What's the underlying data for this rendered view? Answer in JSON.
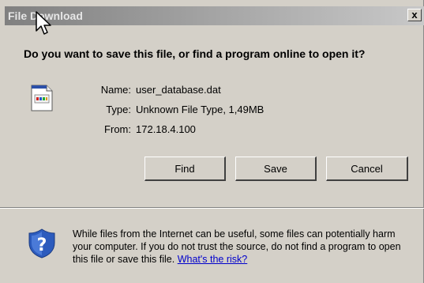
{
  "dialog": {
    "title": "File Download",
    "close_label": "x",
    "question": "Do you want to save this file, or find a program online to open it?"
  },
  "file": {
    "icon": "file-dat-icon",
    "name_label": "Name:",
    "name_value": "user_database.dat",
    "type_label": "Type:",
    "type_value": "Unknown File Type, 1,49MB",
    "from_label": "From:",
    "from_value": "172.18.4.100"
  },
  "buttons": {
    "find": "Find",
    "save": "Save",
    "cancel": "Cancel"
  },
  "warning": {
    "icon": "shield-question-icon",
    "text": "While files from the Internet can be useful, some files can potentially harm your computer. If you do not trust the source, do not find a program to open this file or save this file. ",
    "link": "What's the risk?"
  },
  "colors": {
    "dialog_bg": "#d4d0c8",
    "link": "#0000cc",
    "shield": "#2c5bbd"
  }
}
